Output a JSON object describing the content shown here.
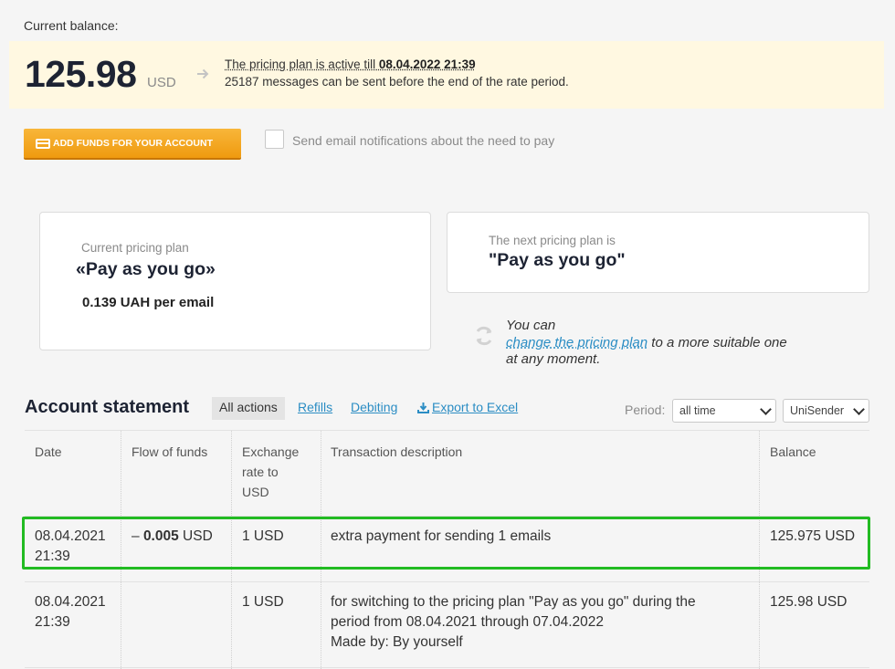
{
  "balance": {
    "label": "Current balance:",
    "amount": "125.98",
    "currency": "USD",
    "plan_active_prefix": "The pricing plan is active till ",
    "plan_active_date": "08.04.2022 21:39",
    "messages_info": "25187 messages can be sent before the end of the rate period."
  },
  "actions": {
    "add_funds_label": "ADD FUNDS FOR YOUR ACCOUNT",
    "notify_label": "Send email notifications about the need to pay"
  },
  "current_plan": {
    "caption": "Current pricing plan",
    "name": "«Pay as you go»",
    "price": "0.139 UAH per email"
  },
  "next_plan": {
    "caption": "The next pricing plan is",
    "name": "\"Pay as you go\""
  },
  "change_plan": {
    "line1": "You can",
    "link": "change the pricing plan",
    "after_link": " to a more suitable one",
    "line3": "at any moment."
  },
  "statement": {
    "title": "Account statement",
    "tabs": {
      "all": "All actions",
      "refills": "Refills",
      "debiting": "Debiting",
      "export": "Export to Excel"
    },
    "period_label": "Period:",
    "period_value": "all time",
    "sender_value": "UniSender",
    "columns": {
      "date": "Date",
      "flow": "Flow of funds",
      "rate_l1": "Exchange",
      "rate_l2": "rate to",
      "rate_l3": "USD",
      "desc": "Transaction description",
      "balance": "Balance"
    },
    "rows": [
      {
        "date_l1": "08.04.2021",
        "date_l2": "21:39",
        "flow_prefix": "– ",
        "flow_amount": "0.005",
        "flow_currency": " USD",
        "rate": "1 USD",
        "desc_l1": "extra payment for sending 1 emails",
        "balance": "125.975 USD"
      },
      {
        "date_l1": "08.04.2021",
        "date_l2": "21:39",
        "rate": "1 USD",
        "desc_l1": "for switching to the pricing plan \"Pay as you go\" during the",
        "desc_l2": "period from 08.04.2021 through 07.04.2022",
        "desc_l3": "Made by: By yourself",
        "balance": "125.98 USD"
      }
    ]
  },
  "colors": {
    "accent_link": "#2b8dc4",
    "button_orange": "#f5a623",
    "highlight_green": "#22bb22",
    "balance_panel": "#fff8e1"
  }
}
